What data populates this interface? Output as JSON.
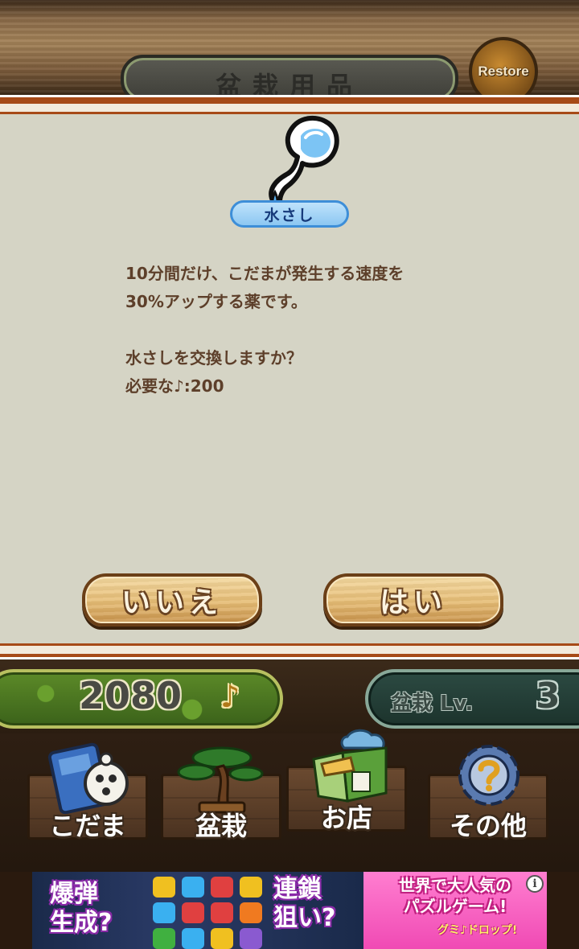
{
  "header": {
    "title": "盆栽用品",
    "restore_label": "Restore"
  },
  "dialog": {
    "item_name": "水さし",
    "description_lines": [
      "10分間だけ、こだまが発生する速度を",
      "30%アップする薬です。",
      "",
      "水さしを交換しますか？",
      "必要な♪:200"
    ],
    "no_label": "いいえ",
    "yes_label": "はい"
  },
  "status": {
    "notes": "2080",
    "note_icon": "♪",
    "level_label": "盆栽 Lv.",
    "level_value": "3"
  },
  "nav": {
    "items": [
      {
        "label": "こだま",
        "icon": "kodama-book-icon"
      },
      {
        "label": "盆栽",
        "icon": "bonsai-tree-icon"
      },
      {
        "label": "お店",
        "icon": "shop-icon"
      },
      {
        "label": "その他",
        "icon": "gear-question-icon"
      }
    ]
  },
  "ad": {
    "left_text_1": "爆弾\n生成?",
    "left_text_2": "連鎖\n狙い?",
    "right_text": "世界で大人気の\nパズルゲーム!",
    "brand": "グミ♪ドロップ!",
    "info_glyph": "i"
  },
  "colors": {
    "dialog_bg": "#d5d4c5",
    "stripe": "#a74a17",
    "text": "#5d3f2a",
    "pill_blue": "#3d8ed8"
  }
}
